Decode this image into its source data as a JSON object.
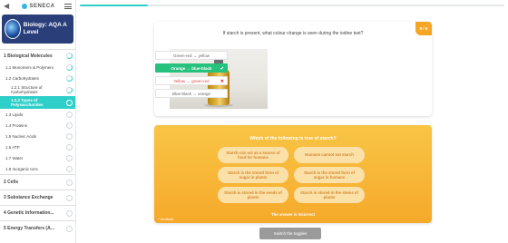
{
  "brand": {
    "name": "SENECA"
  },
  "course": {
    "title": "Biology: AQA A Level"
  },
  "sidebar": {
    "sections": [
      {
        "label": "1 Biological Molecules",
        "expanded": true,
        "items": [
          {
            "label": "1.1 Monomers & Polymers"
          },
          {
            "label": "1.2 Carbohydrates",
            "children": [
              {
                "label": "1.2.1 Structure of Carbohydrates"
              },
              {
                "label": "1.2.2 Types of Polysaccharides",
                "active": true
              }
            ]
          },
          {
            "label": "1.3 Lipids"
          },
          {
            "label": "1.4 Proteins"
          },
          {
            "label": "1.5 Nucleic Acids"
          },
          {
            "label": "1.6 ATP"
          },
          {
            "label": "1.7 Water"
          },
          {
            "label": "1.8 Inorganic Ions"
          }
        ]
      },
      {
        "label": "2 Cells"
      },
      {
        "label": "3 Substance Exchange"
      },
      {
        "label": "4 Genetic Information..."
      },
      {
        "label": "5 Energy Transfers (A..."
      }
    ]
  },
  "progress": {
    "value": 0.16
  },
  "question1": {
    "text": "If starch is present, what colour change is seen during the iodine test?",
    "badge": "5 / 6",
    "options": [
      {
        "label": "Green-red → yellow",
        "state": "neutral"
      },
      {
        "label": "Orange → blue-black",
        "state": "correct",
        "mark": "✔"
      },
      {
        "label": "Yellow → green-red",
        "state": "wrong",
        "mark": "✖"
      },
      {
        "label": "Blue-black → orange",
        "state": "neutral"
      }
    ]
  },
  "question2": {
    "text": "Which of the following is true of starch?",
    "options": [
      "Starch can act as a source of food for humans",
      "Humans cannot eat starch",
      "Starch is the stored form of sugar in plants",
      "Starch is the stored form of sugar in humans",
      "Starch is stored in the seeds of plants",
      "Starch is stored in the stems of plants"
    ],
    "footer": "The answer is incorrect",
    "feedback": "+ feedback"
  },
  "switch_button": {
    "label": "Switch the toggles"
  },
  "colors": {
    "accent": "#2ecfc9",
    "correct": "#27c17e",
    "wrong": "#e24c4c",
    "card_orange": "#f6a92b",
    "sidebar_brand": "#2a3f7a"
  }
}
